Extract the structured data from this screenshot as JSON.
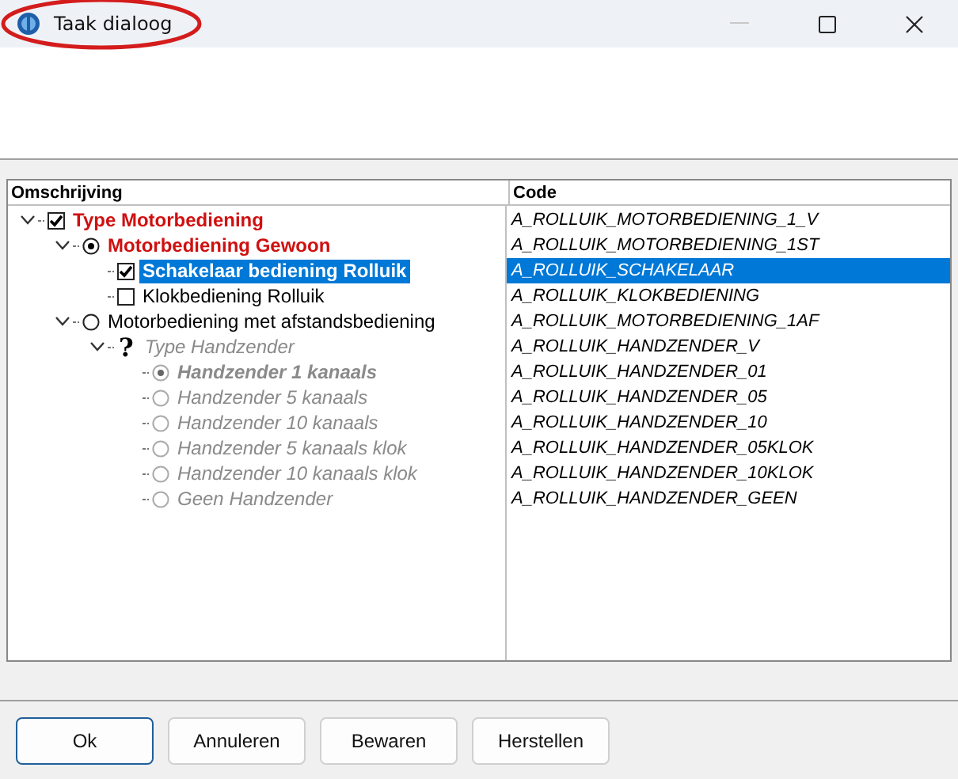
{
  "window": {
    "title": "Taak dialoog",
    "title_circled": true
  },
  "tree": {
    "columns": [
      "Omschrijving",
      "Code"
    ],
    "items": [
      {
        "label": "Type Motorbediening",
        "code": "A_ROLLUIK_MOTORBEDIENING_1_V",
        "kind": "checkbox",
        "checked": true,
        "selected": false,
        "disabled": false,
        "expanded": true,
        "children": [
          {
            "label": "Motorbediening Gewoon",
            "code": "A_ROLLUIK_MOTORBEDIENING_1ST",
            "kind": "radio",
            "checked": true,
            "selected": false,
            "disabled": false,
            "expanded": true,
            "children": [
              {
                "label": "Schakelaar bediening Rolluik",
                "code": "A_ROLLUIK_SCHAKELAAR",
                "kind": "checkbox",
                "checked": true,
                "selected": true,
                "disabled": false
              },
              {
                "label": "Klokbediening Rolluik",
                "code": "A_ROLLUIK_KLOKBEDIENING",
                "kind": "checkbox",
                "checked": false,
                "selected": false,
                "disabled": false
              }
            ]
          },
          {
            "label": "Motorbediening met afstandsbediening",
            "code": "A_ROLLUIK_MOTORBEDIENING_1AF",
            "kind": "radio",
            "checked": false,
            "selected": false,
            "disabled": false,
            "expanded": true,
            "children": [
              {
                "label": "Type Handzender",
                "code": "A_ROLLUIK_HANDZENDER_V",
                "kind": "question",
                "symbol": "?",
                "selected": false,
                "disabled": true,
                "expanded": true,
                "children": [
                  {
                    "label": "Handzender 1 kanaals",
                    "code": "A_ROLLUIK_HANDZENDER_01",
                    "kind": "radio",
                    "checked": true,
                    "selected": false,
                    "disabled": true
                  },
                  {
                    "label": "Handzender 5 kanaals",
                    "code": "A_ROLLUIK_HANDZENDER_05",
                    "kind": "radio",
                    "checked": false,
                    "selected": false,
                    "disabled": true
                  },
                  {
                    "label": "Handzender 10 kanaals",
                    "code": "A_ROLLUIK_HANDZENDER_10",
                    "kind": "radio",
                    "checked": false,
                    "selected": false,
                    "disabled": true
                  },
                  {
                    "label": "Handzender 5 kanaals klok",
                    "code": "A_ROLLUIK_HANDZENDER_05KLOK",
                    "kind": "radio",
                    "checked": false,
                    "selected": false,
                    "disabled": true
                  },
                  {
                    "label": "Handzender 10 kanaals klok",
                    "code": "A_ROLLUIK_HANDZENDER_10KLOK",
                    "kind": "radio",
                    "checked": false,
                    "selected": false,
                    "disabled": true
                  },
                  {
                    "label": "Geen Handzender",
                    "code": "A_ROLLUIK_HANDZENDER_GEEN",
                    "kind": "radio",
                    "checked": false,
                    "selected": false,
                    "disabled": true
                  }
                ]
              }
            ]
          }
        ]
      }
    ]
  },
  "buttons": [
    {
      "label": "Ok",
      "default": true
    },
    {
      "label": "Annuleren",
      "default": false
    },
    {
      "label": "Bewaren",
      "default": false
    },
    {
      "label": "Herstellen",
      "default": false
    }
  ]
}
